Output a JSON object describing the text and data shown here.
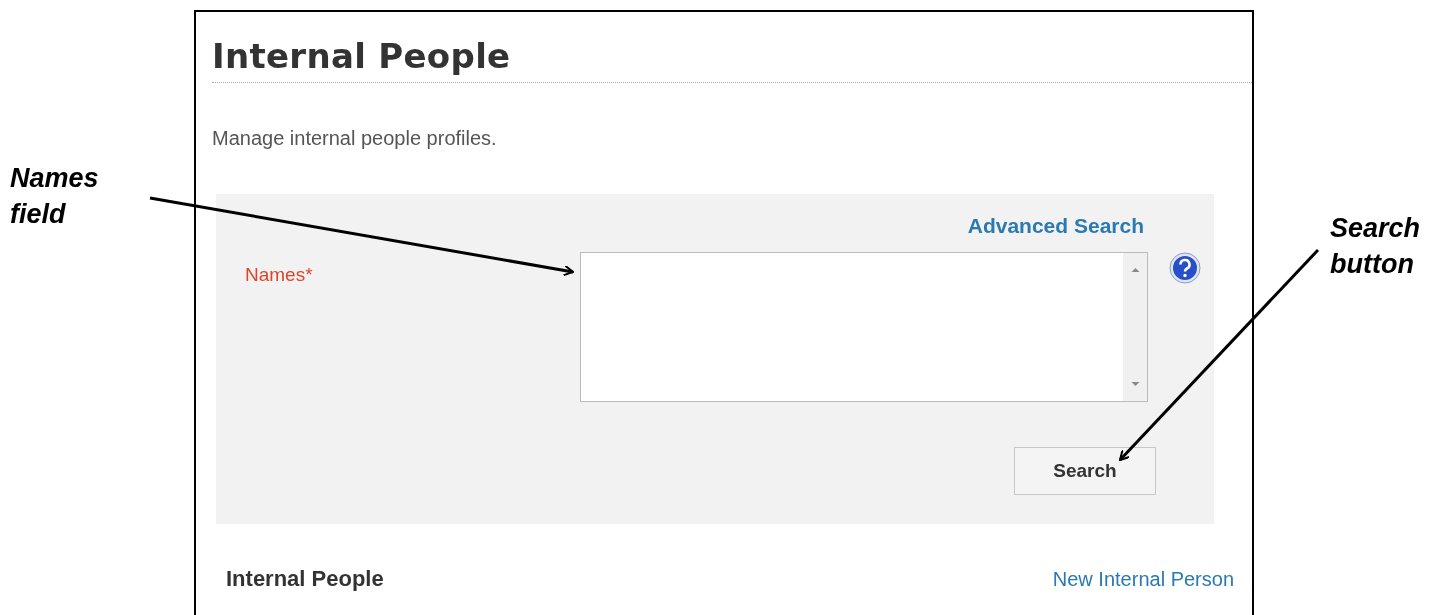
{
  "left_note": "Names field",
  "right_note": "Search button",
  "page": {
    "title": "Internal People",
    "description": "Manage internal people profiles.",
    "search_panel": {
      "advanced_link": "Advanced Search",
      "field_label": "Names*",
      "button": "Search"
    },
    "results": {
      "heading": "Internal People",
      "new_link": "New Internal Person"
    }
  }
}
